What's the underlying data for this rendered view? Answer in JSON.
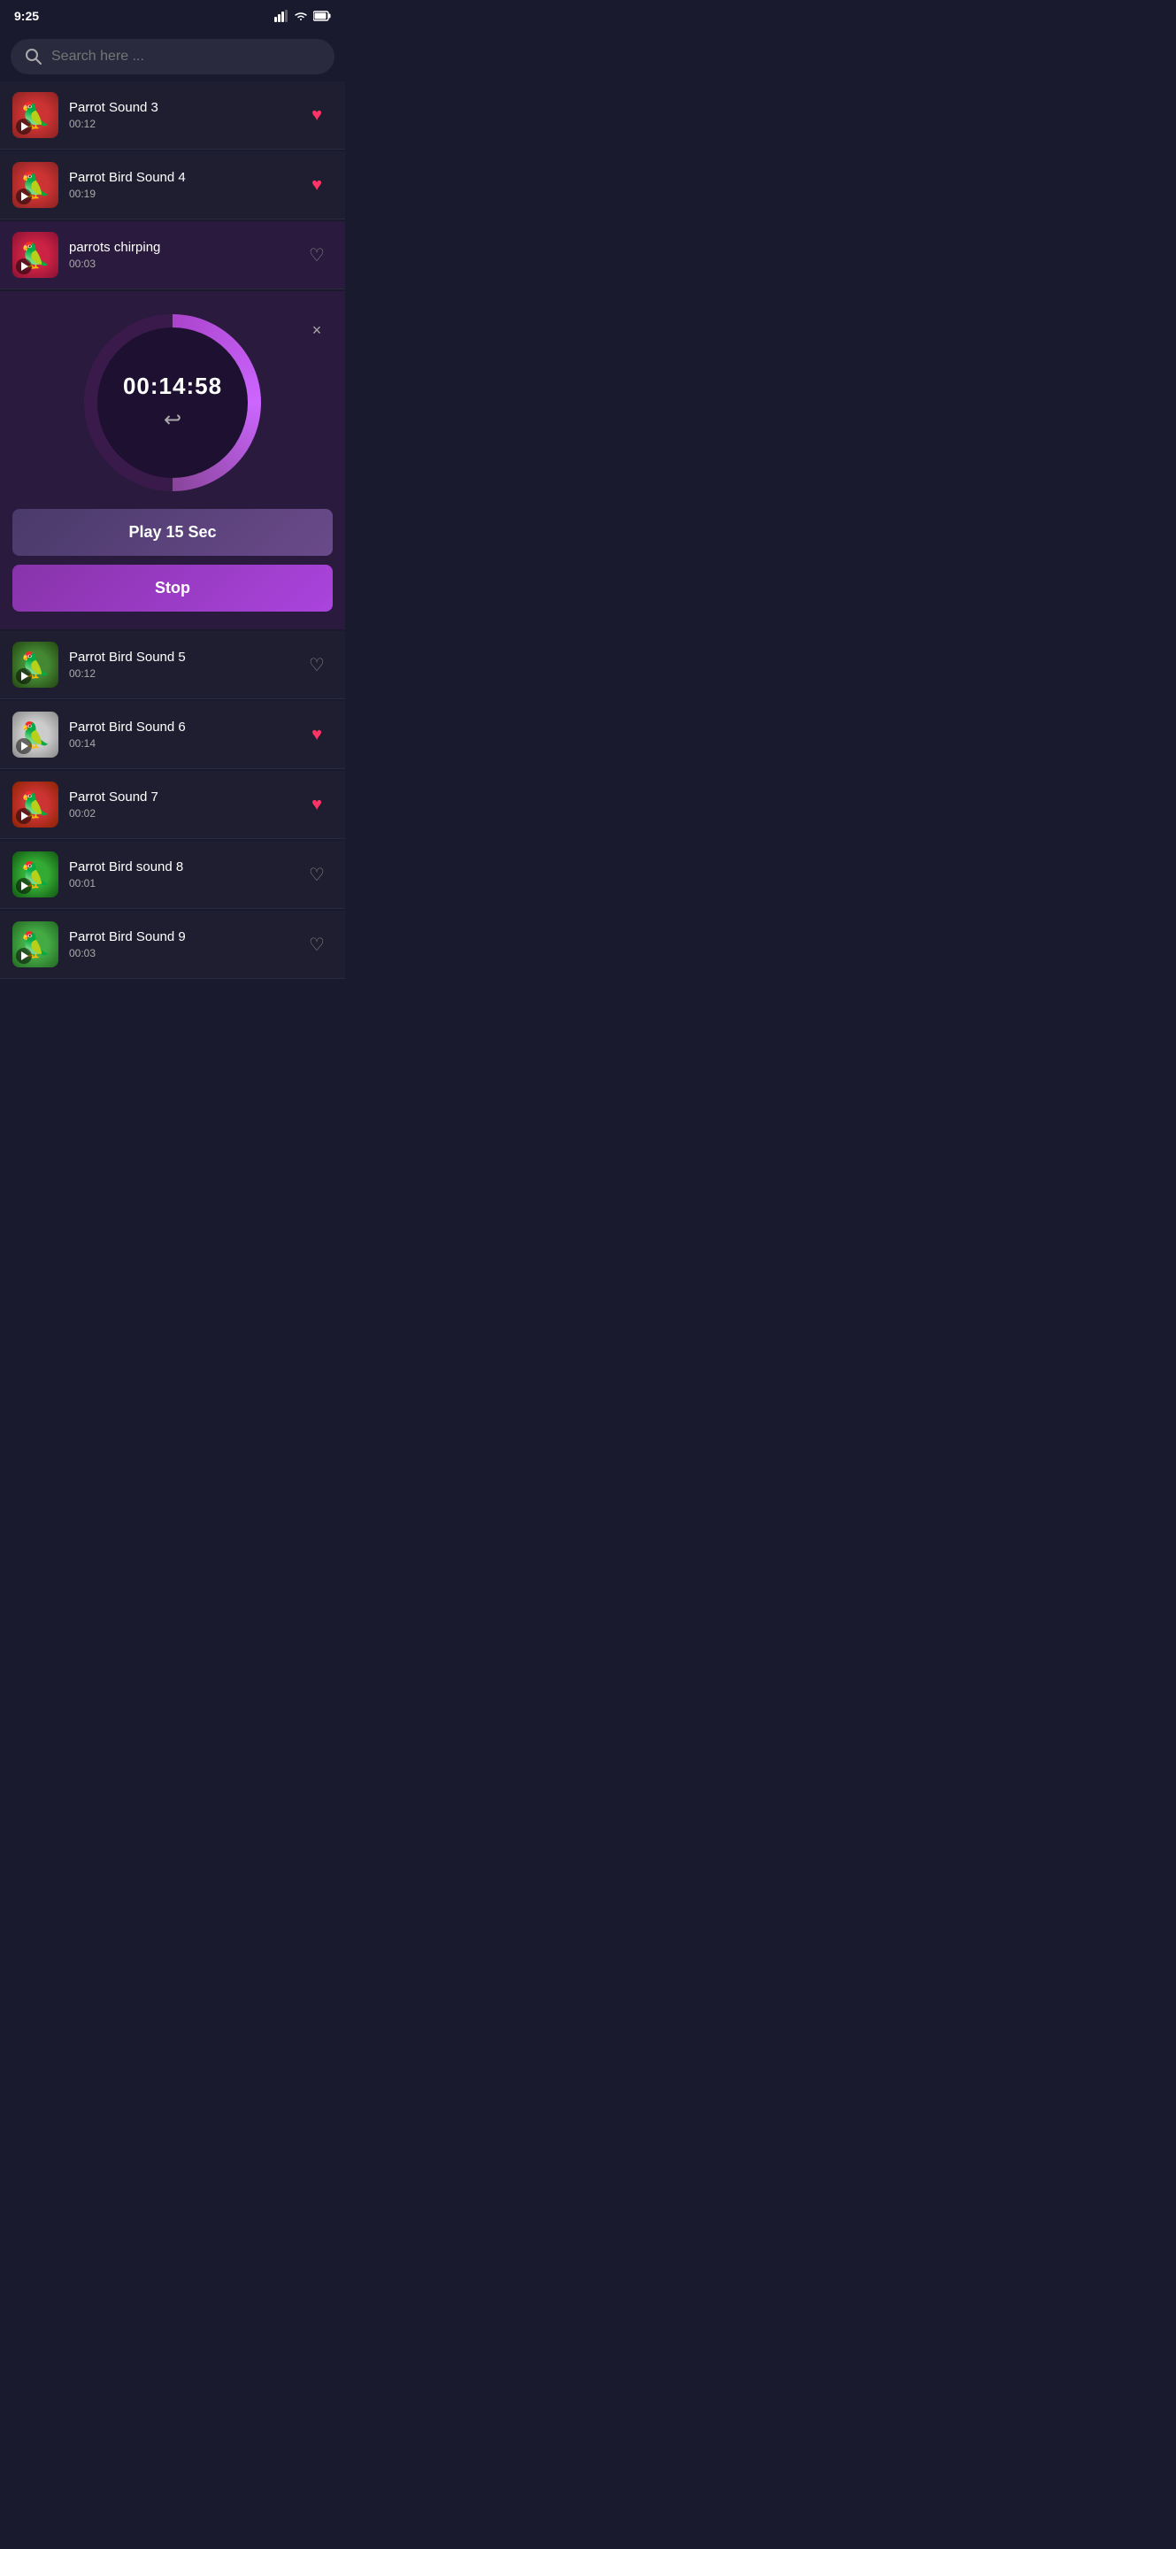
{
  "statusBar": {
    "time": "9:25",
    "icons": [
      "signal",
      "wifi",
      "battery"
    ]
  },
  "search": {
    "placeholder": "Search here ..."
  },
  "sounds": [
    {
      "id": "parrot-sound-3",
      "title": "Parrot Sound 3",
      "duration": "00:12",
      "favorited": true,
      "thumbClass": "thumb-parrot3",
      "emoji": "🦜"
    },
    {
      "id": "parrot-bird-sound-4",
      "title": "Parrot Bird Sound 4",
      "duration": "00:19",
      "favorited": true,
      "thumbClass": "thumb-parrot4",
      "emoji": "🦜"
    }
  ],
  "activeSound": {
    "id": "parrots-chirping",
    "title": "parrots chirping",
    "duration": "00:03",
    "favorited": false,
    "thumbClass": "thumb-chirping",
    "emoji": "🦜",
    "timer": "00:14:58"
  },
  "playerButtons": {
    "play15Label": "Play 15 Sec",
    "stopLabel": "Stop",
    "closeLabel": "×"
  },
  "soundsBelow": [
    {
      "id": "parrot-bird-sound-5",
      "title": "Parrot Bird Sound 5",
      "duration": "00:12",
      "favorited": false,
      "thumbClass": "thumb-parrot5",
      "emoji": "🦜"
    },
    {
      "id": "parrot-bird-sound-6",
      "title": "Parrot Bird Sound 6",
      "duration": "00:14",
      "favorited": true,
      "thumbClass": "thumb-parrot6",
      "emoji": "🦜"
    },
    {
      "id": "parrot-sound-7",
      "title": "Parrot Sound 7",
      "duration": "00:02",
      "favorited": true,
      "thumbClass": "thumb-parrot7",
      "emoji": "🦜"
    },
    {
      "id": "parrot-bird-sound-8",
      "title": "Parrot Bird sound 8",
      "duration": "00:01",
      "favorited": false,
      "thumbClass": "thumb-parrot8",
      "emoji": "🦜"
    },
    {
      "id": "parrot-bird-sound-9",
      "title": "Parrot Bird Sound 9",
      "duration": "00:03",
      "favorited": false,
      "thumbClass": "thumb-parrot9",
      "emoji": "🦜"
    }
  ]
}
